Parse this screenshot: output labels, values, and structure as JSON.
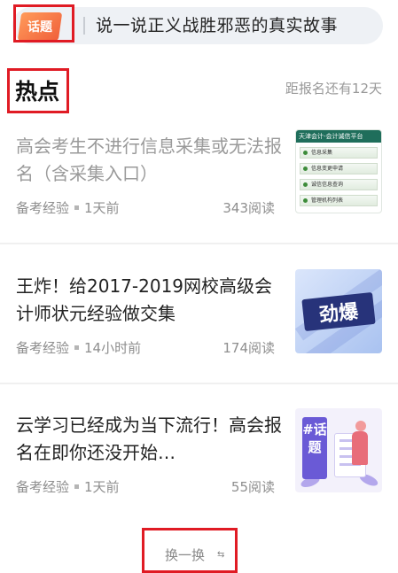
{
  "topic": {
    "badge": "话题",
    "text": "说一说正义战胜邪恶的真实故事"
  },
  "hot": {
    "title": "热点",
    "countdown": "距报名还有12天"
  },
  "articles": [
    {
      "headline": "高会考生不进行信息采集或无法报名（含采集入口）",
      "category": "备考经验",
      "time": "1天前",
      "reads": "343阅读",
      "thumb": {
        "header": "天津会计-会计诚信平台",
        "rows": [
          "信息采集",
          "信息变更申请",
          "诚信信息查询",
          "管理机构列表"
        ]
      }
    },
    {
      "headline": "王炸！给2017-2019网校高级会计师状元经验做交集",
      "category": "备考经验",
      "time": "14小时前",
      "reads": "174阅读",
      "thumb": {
        "word": "劲爆"
      }
    },
    {
      "headline": "云学习已经成为当下流行！高会报名在即你还没开始…",
      "category": "备考经验",
      "time": "1天前",
      "reads": "55阅读",
      "thumb": {
        "card": "#话题"
      }
    }
  ],
  "refresh": {
    "label": "换一换",
    "icon": "⇆"
  },
  "colors": {
    "highlight": "#e01b24",
    "badge": "#f0603a",
    "read_text": "#9a9a9a"
  }
}
